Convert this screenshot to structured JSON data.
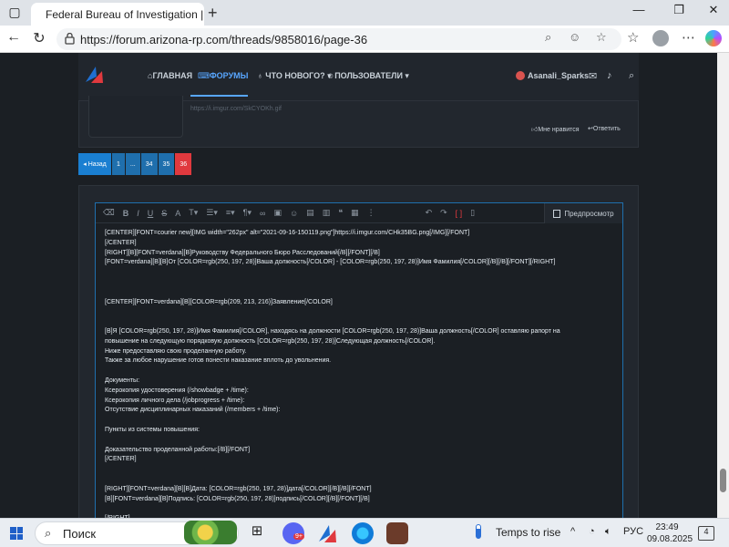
{
  "browser": {
    "tab_title": "Federal Bureau of Investigation ||",
    "tab_close": "✕",
    "new_tab": "+",
    "url": "https://forum.arizona-rp.com/threads/9858016/page-36",
    "window_controls": [
      "—",
      "❐",
      "✕"
    ]
  },
  "site_nav": {
    "items": [
      {
        "icon": "home-icon",
        "label": "ГЛАВНАЯ"
      },
      {
        "icon": "forum-icon",
        "label": "ФОРУМЫ"
      },
      {
        "icon": "bulb-icon",
        "label": "ЧТО НОВОГО?"
      },
      {
        "icon": "users-icon",
        "label": "ПОЛЬЗОВАТЕЛИ"
      }
    ],
    "username": "Asanali_Sparks",
    "active_color": "#58a6ff"
  },
  "post": {
    "link_text": "https://i.imgur.com/SkCYOKh.gif",
    "like_label": "Мне нравится",
    "reply_label": "Ответить"
  },
  "pagination": {
    "back_label": "◂ Назад",
    "pages": [
      "1",
      "...",
      "34",
      "35",
      "36"
    ],
    "current": "36"
  },
  "editor": {
    "toolbar_icons": [
      "eraser-icon",
      "bold-icon",
      "italic-icon",
      "underline-icon",
      "strikethrough-icon",
      "text-color-icon",
      "text-size-icon",
      "font-family-icon",
      "list-icon",
      "align-icon",
      "paragraph-icon",
      "link-icon",
      "image-icon",
      "emoji-icon",
      "media-icon",
      "gallery-icon",
      "quote-icon",
      "code-icon",
      "more-icon",
      "undo-icon",
      "redo-icon",
      "bbcode-icon",
      "draft-icon"
    ],
    "preview_label": "Предпросмотр",
    "lines": [
      "[CENTER][FONT=courier new][IMG width=\"262px\" alt=\"2021-09-16-150119.png\"]https://i.imgur.com/CHk35BG.png[/IMG][/FONT]",
      "[/CENTER]",
      "[RIGHT][B][FONT=verdana][B]Руководству Федерального Бюро Расследований[/B][/FONT][/B]",
      "[FONT=verdana][B][B]От [COLOR=rgb(250, 197, 28)]Ваша должность[/COLOR] - [COLOR=rgb(250, 197, 28)]Имя Фамилия[/COLOR][/B][/B][/FONT][/RIGHT]",
      "",
      "",
      "",
      "[CENTER][FONT=verdana][B][COLOR=rgb(209, 213, 216)]Заявление[/COLOR]",
      "",
      "",
      "[B]Я [COLOR=rgb(250, 197, 28)]Имя Фамилия[/COLOR], находясь на должности [COLOR=rgb(250, 197, 28)]Ваша должность[/COLOR] оставляю рапорт на",
      "повышение на следующую порядковую должность [COLOR=rgb(250, 197, 28)]Следующая должность[/COLOR].",
      "Ниже предоставляю свою проделанную работу.",
      "Также за любое нарушение готов понести наказание вплоть до увольнения.",
      "",
      "Документы:",
      "Ксерокопия удостоверения (/showbadge + /time):",
      "Ксерокопия личного дела (/jobprogress + /time):",
      "Отсутствие дисциплинарных наказаний (/members + /time):",
      "",
      "Пункты из системы повышения:",
      "",
      "Доказательство проделанной работы:[/B][/FONT]",
      "[/CENTER]",
      "",
      "",
      "[RIGHT][FONT=verdana][B][B]Дата: [COLOR=rgb(250, 197, 28)]дата[/COLOR][/B][/B][/FONT]",
      "[B][FONT=verdana][B]Подпись: [COLOR=rgb(250, 197, 28)]подпись[/COLOR][/B][/FONT][/B]",
      "",
      "[/RIGHT]"
    ]
  },
  "taskbar": {
    "search_placeholder": "Поиск",
    "weather": "Temps to rise",
    "language": "РУС",
    "time": "23:49",
    "date": "09.08.2025",
    "notifications": "4",
    "badge_99": "9+"
  }
}
